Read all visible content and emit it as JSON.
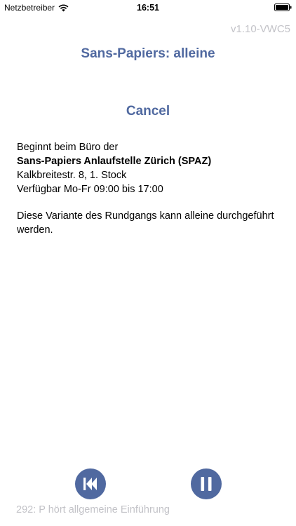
{
  "status_bar": {
    "carrier": "Netzbetreiber",
    "time": "16:51",
    "icons": [
      "wifi-icon",
      "battery-icon"
    ]
  },
  "version": "v1.10-VWC5",
  "title": "Sans-Papiers: alleine",
  "cancel_label": "Cancel",
  "description": {
    "line1": "Beginnt beim Büro der",
    "org": "Sans-Papiers Anlaufstelle Zürich (SPAZ)",
    "address": "Kalkbreitestr. 8, 1. Stock",
    "hours": "Verfügbar Mo-Fr 09:00 bis 17:00",
    "note": "Diese Variante des Rundgangs kann alleine durchgeführt werden."
  },
  "controls": {
    "rewind_icon": "rewind-icon",
    "pause_icon": "pause-icon",
    "accent_color": "#5069a0"
  },
  "track_label": "292: P hört allgemeine Einführung"
}
